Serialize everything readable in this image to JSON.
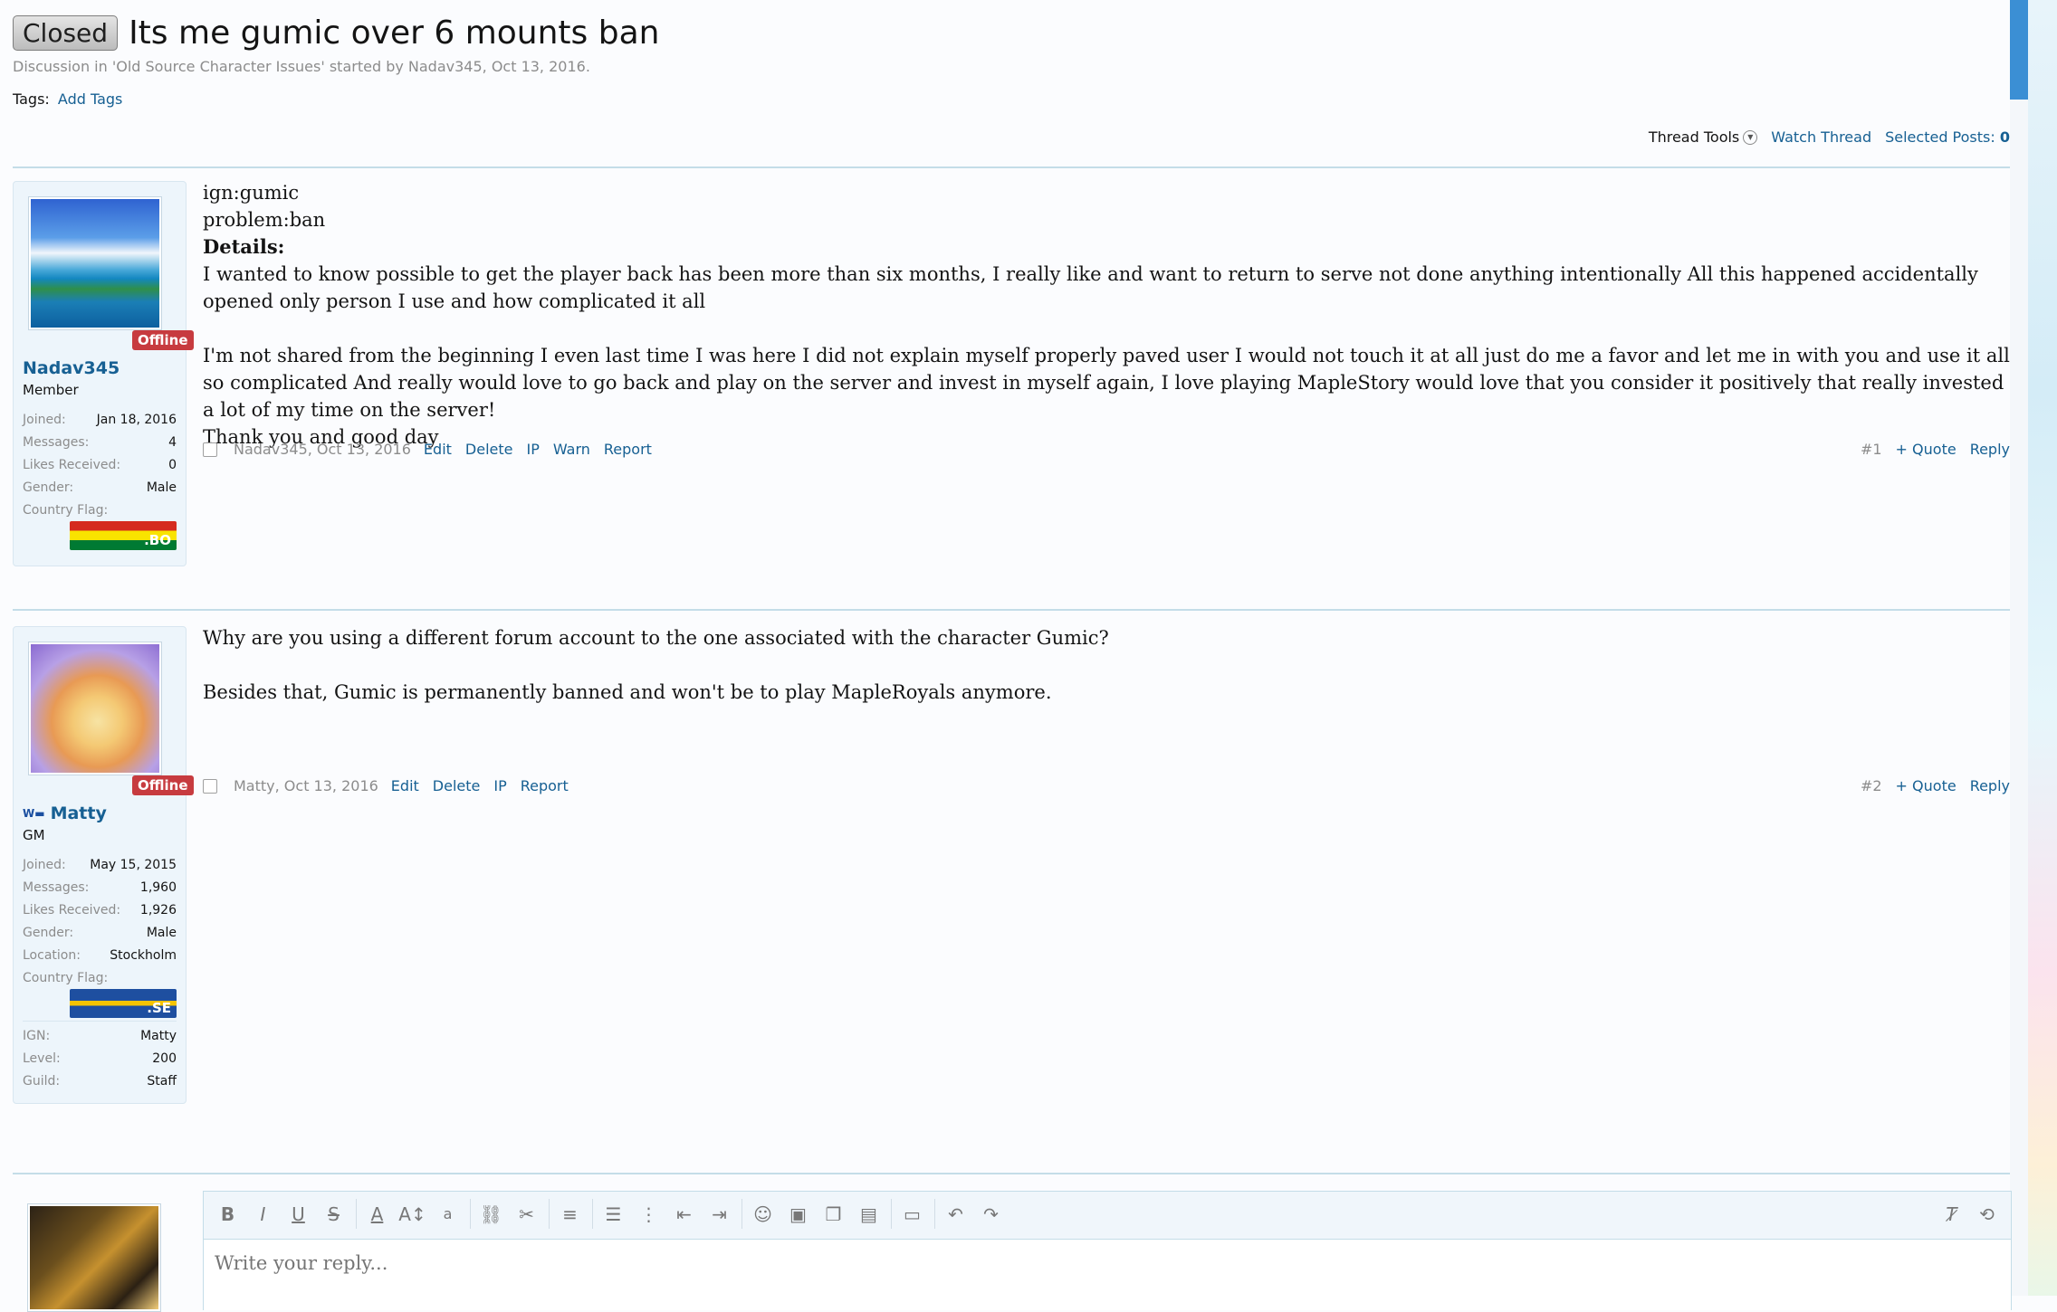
{
  "thread": {
    "prefix": "Closed",
    "title": "Its me gumic over 6 mounts ban",
    "description": "Discussion in 'Old Source Character Issues' started by Nadav345, Oct 13, 2016.",
    "tags_label": "Tags:",
    "add_tags": "Add Tags"
  },
  "tools": {
    "thread_tools": "Thread Tools",
    "watch_thread": "Watch Thread",
    "selected_posts_label": "Selected Posts:",
    "selected_posts_count": "0"
  },
  "posts": [
    {
      "author": "Nadav345",
      "role": "Member",
      "status": "Offline",
      "stats": [
        {
          "k": "Joined:",
          "v": "Jan 18, 2016"
        },
        {
          "k": "Messages:",
          "v": "4"
        },
        {
          "k": "Likes Received:",
          "v": "0"
        },
        {
          "k": "Gender:",
          "v": "Male"
        },
        {
          "k": "Country Flag:",
          "v": ""
        }
      ],
      "flag_code": ".BO",
      "lines": {
        "l1": "ign:gumic",
        "l2": "problem:ban",
        "l3": "Details:",
        "l4": "I wanted to know possible to get the player back has been more than six months, I really like and want to return to serve not done anything intentionally All this happened accidentally opened only person I use and how complicated it all",
        "l5": "I'm not shared from the beginning I even last time I was here I did not explain myself properly paved user I would not touch it at all just do me a favor and let me in with you and use it all so complicated And really would love to go back and play on the server and invest in myself again, I love playing MapleStory would love that you consider it positively that really invested a lot of my time on the server!",
        "l6": "Thank you and good day"
      },
      "meta": "Nadav345, Oct 13, 2016",
      "links": [
        "Edit",
        "Delete",
        "IP",
        "Warn",
        "Report"
      ],
      "num": "#1",
      "quote": "+ Quote",
      "reply": "Reply"
    },
    {
      "author": "Matty",
      "role": "GM",
      "status": "Offline",
      "stats": [
        {
          "k": "Joined:",
          "v": "May 15, 2015"
        },
        {
          "k": "Messages:",
          "v": "1,960"
        },
        {
          "k": "Likes Received:",
          "v": "1,926"
        },
        {
          "k": "Gender:",
          "v": "Male"
        },
        {
          "k": "Location:",
          "v": "Stockholm"
        },
        {
          "k": "Country Flag:",
          "v": ""
        }
      ],
      "flag_code": ".SE",
      "stats2": [
        {
          "k": "IGN:",
          "v": "Matty"
        },
        {
          "k": "Level:",
          "v": "200"
        },
        {
          "k": "Guild:",
          "v": "Staff"
        }
      ],
      "lines": {
        "l1": "Why are you using a different forum account to the one associated with the character Gumic?",
        "l2": "Besides that, Gumic is permanently banned and won't be to play MapleRoyals anymore."
      },
      "meta": "Matty, Oct 13, 2016",
      "links": [
        "Edit",
        "Delete",
        "IP",
        "Report"
      ],
      "num": "#2",
      "quote": "+ Quote",
      "reply": "Reply"
    }
  ],
  "editor": {
    "placeholder": "Write your reply..."
  }
}
